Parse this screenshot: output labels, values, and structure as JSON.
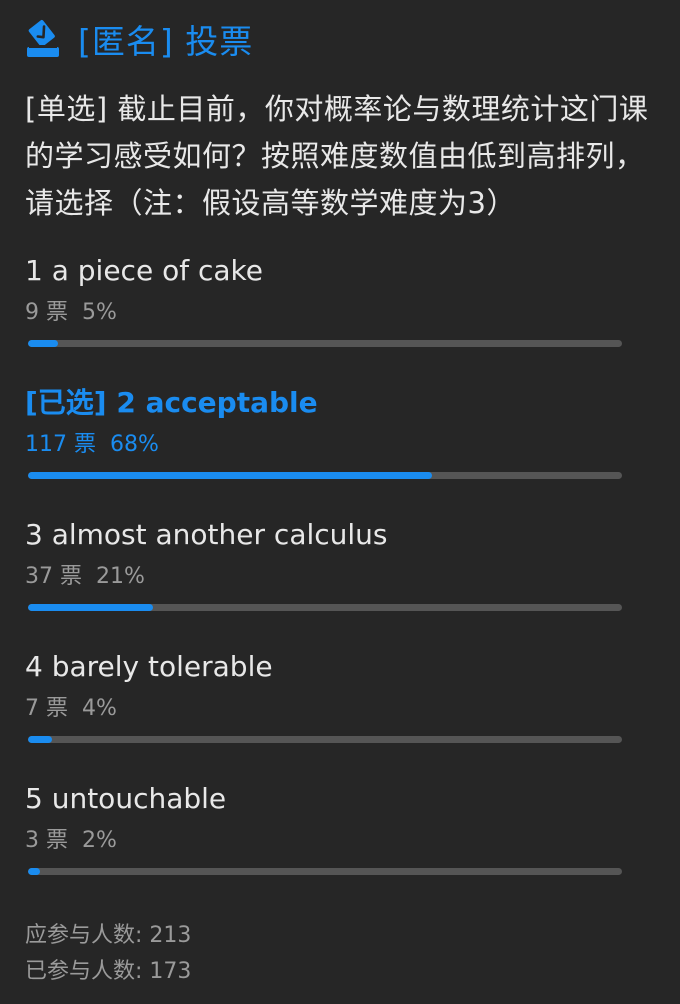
{
  "header": {
    "title": "[匿名] 投票",
    "icon": "ballot-box-icon",
    "accent_color": "#1a8cf0"
  },
  "question": {
    "text": "[单选] 截止目前，你对概率论与数理统计这门课的学习感受如何？按照难度数值由低到高排列，请选择（注：假设高等数学难度为3）"
  },
  "options": [
    {
      "label": "1 a piece of cake",
      "votes": "9 票",
      "percent": "5%",
      "fraction": 0.05,
      "selected": false
    },
    {
      "label": "[已选] 2 acceptable",
      "votes": "117 票",
      "percent": "68%",
      "fraction": 0.68,
      "selected": true
    },
    {
      "label": "3 almost another calculus",
      "votes": "37 票",
      "percent": "21%",
      "fraction": 0.21,
      "selected": false
    },
    {
      "label": "4 barely tolerable",
      "votes": "7 票",
      "percent": "4%",
      "fraction": 0.04,
      "selected": false
    },
    {
      "label": "5 untouchable",
      "votes": "3 票",
      "percent": "2%",
      "fraction": 0.02,
      "selected": false
    }
  ],
  "footer": {
    "expected": "应参与人数: 213",
    "participated": "已参与人数: 173"
  }
}
